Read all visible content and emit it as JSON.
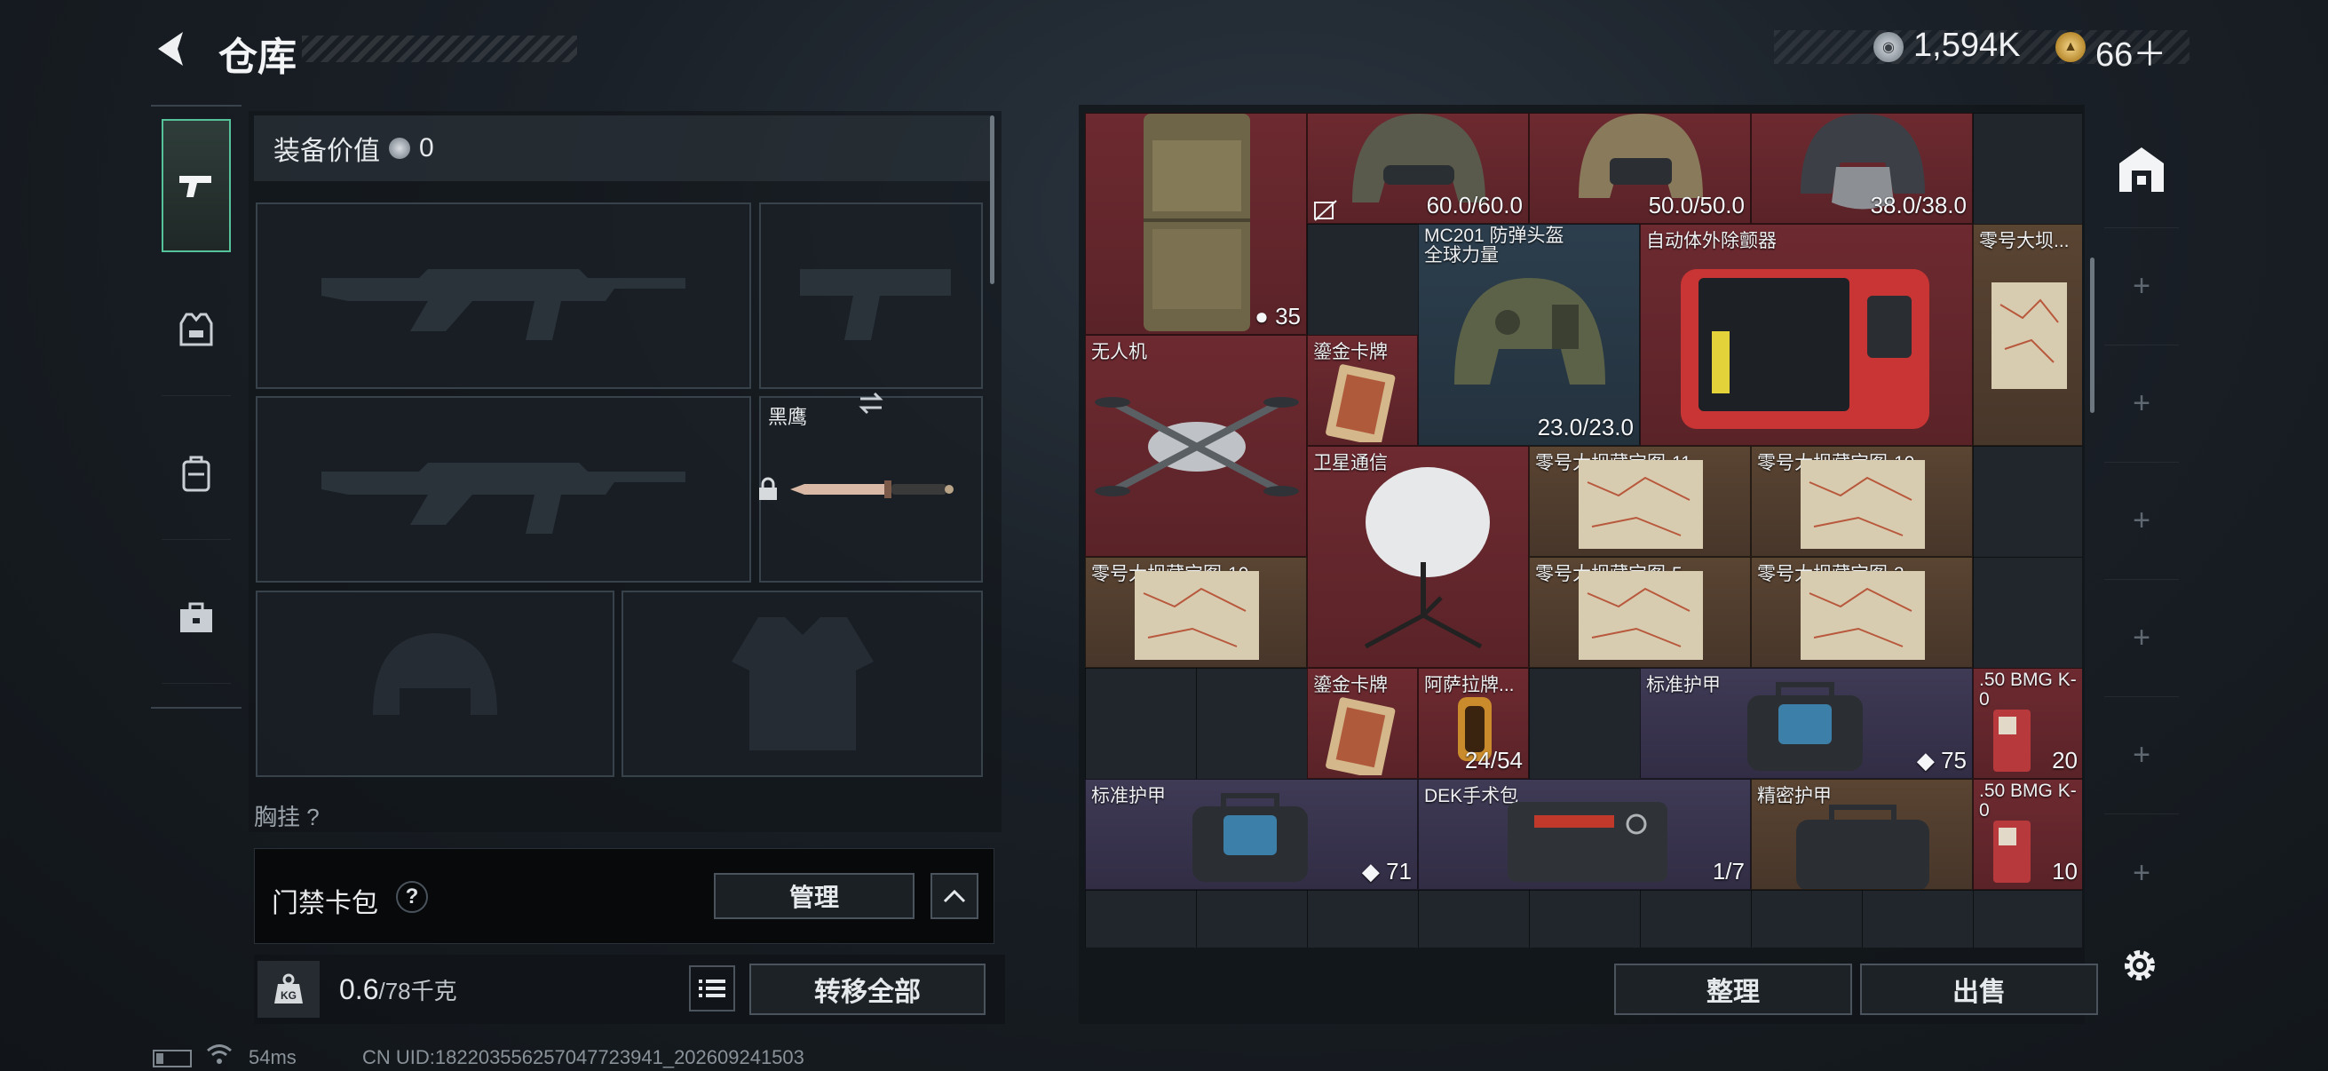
{
  "header": {
    "title": "仓库",
    "silver_amount": "1,594K",
    "gold_amount": "66＋"
  },
  "left_rail": {
    "tabs": [
      {
        "name": "weapons",
        "icon": "pistol-icon",
        "active": true
      },
      {
        "name": "gear",
        "icon": "vest-icon",
        "active": false
      },
      {
        "name": "backpack",
        "icon": "backpack-icon",
        "active": false
      },
      {
        "name": "case",
        "icon": "toolbox-icon",
        "active": false
      }
    ]
  },
  "equipment": {
    "value_label": "装备价值",
    "value_amount": "0",
    "melee_name": "黑鹰",
    "chest_label": "胸挂",
    "chest_help": "?",
    "slots": [
      "primary-weapon",
      "pistol",
      "secondary-weapon",
      "melee",
      "helmet",
      "armor"
    ]
  },
  "keycard": {
    "label": "门禁卡包",
    "help": "?",
    "manage_label": "管理"
  },
  "weight": {
    "icon_text": "KG",
    "current": "0.6",
    "capacity": "/78千克",
    "transfer_all_label": "转移全部"
  },
  "status": {
    "ping": "54ms",
    "uid": "CN UID:182203556257047723941_202609241503"
  },
  "stash": {
    "items": [
      {
        "id": "rig",
        "name": "",
        "value": "35",
        "value_icon": "bag-icon",
        "rarity": "red"
      },
      {
        "id": "helmet1",
        "name": "",
        "value": "60.0/60.0",
        "rarity": "red"
      },
      {
        "id": "helmet2",
        "name": "",
        "value": "50.0/50.0",
        "rarity": "red"
      },
      {
        "id": "helmet3",
        "name": "",
        "value": "38.0/38.0",
        "rarity": "red"
      },
      {
        "id": "mc201",
        "name": "MC201 防弹头盔 全球力量",
        "value": "23.0/23.0",
        "rarity": "blue"
      },
      {
        "id": "aed",
        "name": "自动体外除颤器",
        "value": "",
        "rarity": "red"
      },
      {
        "id": "map-top",
        "name": "零号大坝...",
        "value": "",
        "rarity": "gold"
      },
      {
        "id": "drone",
        "name": "无人机",
        "value": "",
        "rarity": "red"
      },
      {
        "id": "card1",
        "name": "鎏金卡牌",
        "value": "",
        "rarity": "red"
      },
      {
        "id": "satcom",
        "name": "卫星通信",
        "value": "",
        "rarity": "red"
      },
      {
        "id": "map11",
        "name": "零号大坝藏宝图-11",
        "value": "",
        "rarity": "gold"
      },
      {
        "id": "map10a",
        "name": "零号大坝藏宝图-10",
        "value": "",
        "rarity": "gold"
      },
      {
        "id": "map10b",
        "name": "零号大坝藏宝图-10",
        "value": "",
        "rarity": "gold"
      },
      {
        "id": "map5",
        "name": "零号大坝藏宝图-5",
        "value": "",
        "rarity": "gold"
      },
      {
        "id": "map3",
        "name": "零号大坝藏宝图-3",
        "value": "",
        "rarity": "gold"
      },
      {
        "id": "card2",
        "name": "鎏金卡牌",
        "value": "",
        "rarity": "red"
      },
      {
        "id": "ahsarah",
        "name": "阿萨拉牌...",
        "value": "24/54",
        "rarity": "red"
      },
      {
        "id": "armor1",
        "name": "标准护甲",
        "value": "75",
        "value_icon": "shield-icon",
        "rarity": "purple"
      },
      {
        "id": "bmg1",
        "name": ".50 BMG K-0",
        "value": "20",
        "rarity": "red"
      },
      {
        "id": "armor2",
        "name": "标准护甲",
        "value": "71",
        "value_icon": "shield-icon",
        "rarity": "purple"
      },
      {
        "id": "dek",
        "name": "DEK手术包",
        "value": "1/7",
        "rarity": "purple"
      },
      {
        "id": "precise",
        "name": "精密护甲",
        "value": "",
        "rarity": "gold"
      },
      {
        "id": "bmg2",
        "name": ".50 BMG K-0",
        "value": "10",
        "rarity": "red"
      }
    ],
    "sort_label": "整理",
    "sell_label": "出售"
  },
  "right_rail": {
    "tabs": [
      "stash-icon",
      "add-icon",
      "add-icon",
      "add-icon",
      "add-icon",
      "add-icon",
      "add-icon"
    ],
    "add_symbol": "+"
  }
}
